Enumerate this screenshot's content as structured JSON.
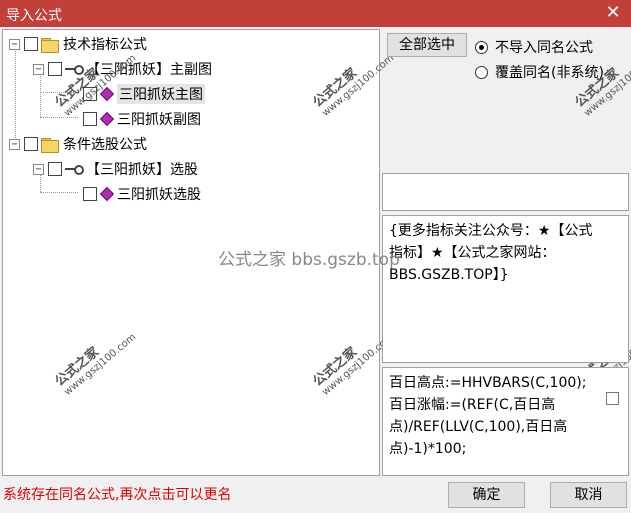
{
  "window": {
    "title": "导入公式",
    "close_glyph": "✕"
  },
  "tree": {
    "groups": [
      {
        "label": "技术指标公式",
        "children": [
          {
            "label": "【三阳抓妖】主副图",
            "children": [
              {
                "label": "三阳抓妖主图"
              },
              {
                "label": "三阳抓妖副图"
              }
            ]
          }
        ]
      },
      {
        "label": "条件选股公式",
        "children": [
          {
            "label": "【三阳抓妖】选股",
            "children": [
              {
                "label": "三阳抓妖选股"
              }
            ]
          }
        ]
      }
    ]
  },
  "actions": {
    "select_all_label": "全部选中",
    "radio_options": [
      {
        "label": "不导入同名公式",
        "checked": true
      },
      {
        "label": "覆盖同名(非系统)",
        "checked": false
      }
    ]
  },
  "description_text": "{更多指标关注公众号：★【公式指标】★【公式之家网站：BBS.GSZB.TOP】}",
  "code_text": "百日高点:=HHVBARS(C,100);\n百日涨幅:=(REF(C,百日高点)/REF(LLV(C,100),百日高点)-1)*100;",
  "status_message": "系统存在同名公式,再次点击可以更名",
  "buttons": {
    "ok_label": "确定",
    "cancel_label": "取消"
  },
  "watermark": {
    "brand": "公式之家",
    "url": "www.gszj100.com",
    "center_text": "公式之家 bbs.gszb.top"
  }
}
